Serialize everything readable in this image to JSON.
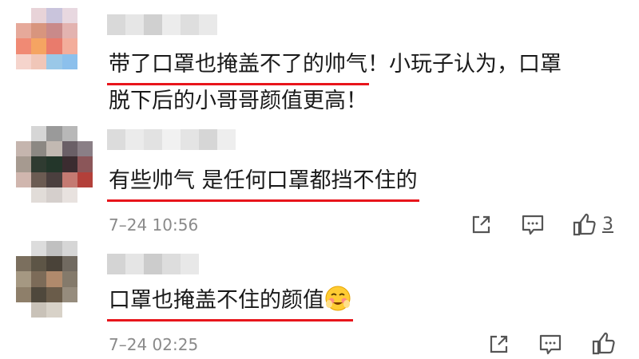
{
  "comments": [
    {
      "line1_highlight": "带了口罩也掩盖不了的帅气",
      "line1_rest": "！小玩子认为，口罩",
      "line2": "脱下后的小哥哥颜值更高！",
      "avatar_colors": [
        "#ffffff",
        "#e8d3d8",
        "#c9c4dc",
        "#e8d8e0",
        "#ffffff",
        "#e6a99a",
        "#d8957e",
        "#c98a8a",
        "#e3b3b0",
        "#ffffff",
        "#f08a74",
        "#f5a462",
        "#e97b6c",
        "#f3ad9b",
        "#ffffff",
        "#f5d4cc",
        "#f0c6b8",
        "#9ac8e8",
        "#8cc0ec",
        "#ffffff",
        "#ffffff",
        "#ffffff",
        "#ffffff",
        "#ffffff",
        "#ffffff"
      ]
    },
    {
      "line1_highlight": "有些帅气 是任何口罩都挡不住的",
      "time": "7–24 10:56",
      "like_count": "3",
      "avatar_colors": [
        "#ffffff",
        "#d6d6d6",
        "#9a9a9a",
        "#b8b8b8",
        "#ffffff",
        "#c5b5ae",
        "#8c8883",
        "#c2b9b2",
        "#6a5f66",
        "#8a7f86",
        "#a69a90",
        "#2f3b31",
        "#23362a",
        "#3b2c30",
        "#8b5659",
        "#d0b6ae",
        "#6b5b52",
        "#4a3f3e",
        "#c47a72",
        "#b3403a",
        "#ffffff",
        "#e1dcd8",
        "#d5cfcc",
        "#e8e2df",
        "#ffffff"
      ]
    },
    {
      "line1_text": "口罩也掩盖不住的颜值",
      "time": "7–24 02:25",
      "avatar_colors": [
        "#ffffff",
        "#dcdcdc",
        "#c0c0c0",
        "#d6d6d6",
        "#ffffff",
        "#7b6f5e",
        "#5d5546",
        "#4a4339",
        "#716a60",
        "#ffffff",
        "#a59882",
        "#7c6b58",
        "#b08a6c",
        "#847a6b",
        "#ffffff",
        "#8e7f6a",
        "#4f483c",
        "#6a5c4a",
        "#968c7d",
        "#ffffff",
        "#ffffff",
        "#c9c2b8",
        "#d8d2c8",
        "#ffffff",
        "#ffffff"
      ]
    }
  ],
  "icons": {
    "share": "share-icon",
    "comment": "comment-icon",
    "like": "thumbs-up-icon",
    "emoji": "blush-emoji-icon"
  },
  "colors": {
    "underline": "#e8151b",
    "timestamp": "#8a8a8a",
    "icon": "#555555"
  }
}
